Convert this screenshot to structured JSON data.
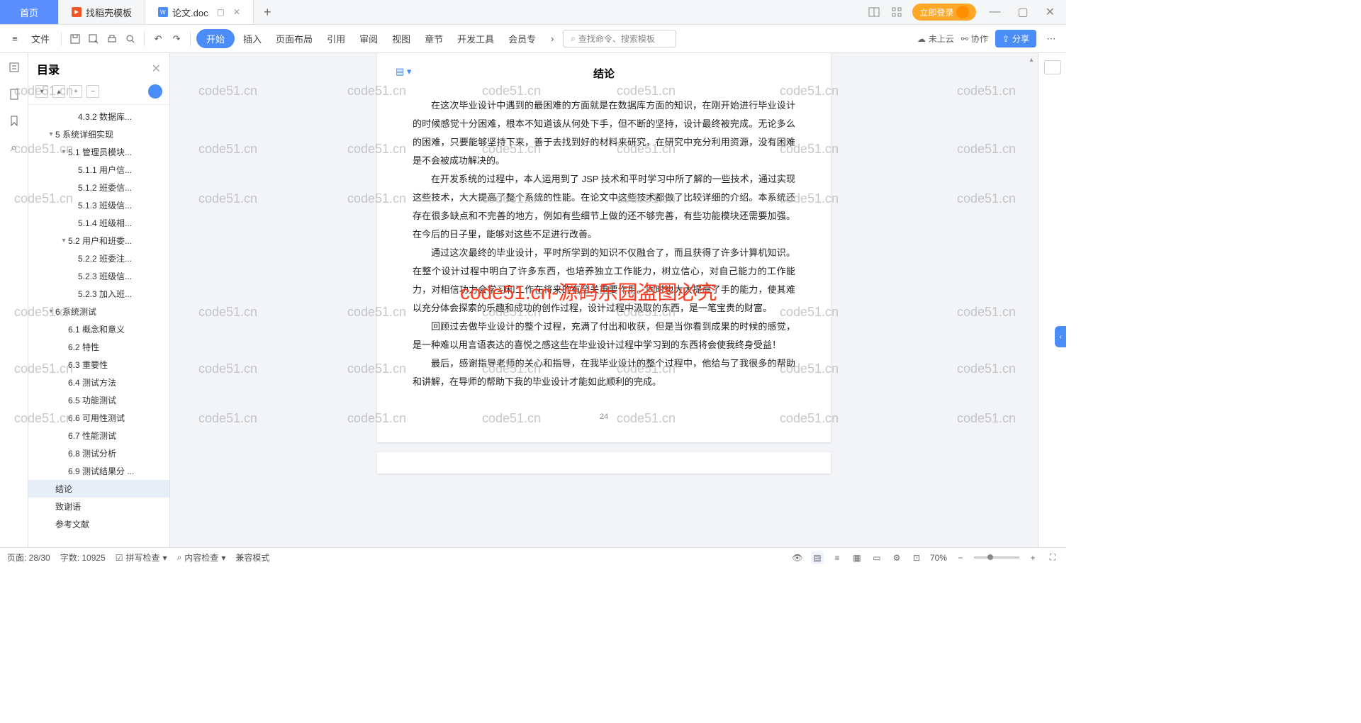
{
  "tabs": {
    "home": "首页",
    "template": "找稻壳模板",
    "doc": "论文.doc",
    "add": "+"
  },
  "topRight": {
    "login": "立即登录"
  },
  "toolbar": {
    "file": "文件",
    "menus": [
      "开始",
      "插入",
      "页面布局",
      "引用",
      "审阅",
      "视图",
      "章节",
      "开发工具",
      "会员专"
    ],
    "search_ph": "查找命令、搜索模板",
    "cloud": "未上云",
    "coop": "协作",
    "share": "分享"
  },
  "outline": {
    "title": "目录",
    "items": [
      {
        "l": 3,
        "t": "4.3.2 数据库...",
        "caret": ""
      },
      {
        "l": 1,
        "t": "5 系统详细实现",
        "caret": "▾"
      },
      {
        "l": 2,
        "t": "5.1 管理员模块...",
        "caret": "▾"
      },
      {
        "l": 3,
        "t": "5.1.1 用户信...",
        "caret": ""
      },
      {
        "l": 3,
        "t": "5.1.2 班委信...",
        "caret": ""
      },
      {
        "l": 3,
        "t": "5.1.3 班级信...",
        "caret": ""
      },
      {
        "l": 3,
        "t": "5.1.4 班级相...",
        "caret": ""
      },
      {
        "l": 2,
        "t": "5.2 用户和班委...",
        "caret": "▾"
      },
      {
        "l": 3,
        "t": "5.2.2 班委注...",
        "caret": ""
      },
      {
        "l": 3,
        "t": "5.2.3 班级信...",
        "caret": ""
      },
      {
        "l": 3,
        "t": "5.2.3 加入班...",
        "caret": ""
      },
      {
        "l": 1,
        "t": "6 系统测试",
        "caret": "▾"
      },
      {
        "l": 2,
        "t": "6.1 概念和意义",
        "caret": ""
      },
      {
        "l": 2,
        "t": "6.2 特性",
        "caret": ""
      },
      {
        "l": 2,
        "t": "6.3 重要性",
        "caret": ""
      },
      {
        "l": 2,
        "t": "6.4 测试方法",
        "caret": ""
      },
      {
        "l": 2,
        "t": "6.5 功能测试",
        "caret": ""
      },
      {
        "l": 2,
        "t": "6.6 可用性测试",
        "caret": ""
      },
      {
        "l": 2,
        "t": "6.7 性能测试",
        "caret": ""
      },
      {
        "l": 2,
        "t": "6.8 测试分析",
        "caret": ""
      },
      {
        "l": 2,
        "t": "6.9 测试结果分 ...",
        "caret": ""
      },
      {
        "l": 1,
        "t": "结论",
        "caret": "",
        "sel": true
      },
      {
        "l": 1,
        "t": "致谢语",
        "caret": ""
      },
      {
        "l": 1,
        "t": "参考文献",
        "caret": ""
      }
    ]
  },
  "doc": {
    "title": "结论",
    "paras": [
      "在这次毕业设计中遇到的最困难的方面就是在数据库方面的知识，在刚开始进行毕业设计的时候感觉十分困难，根本不知道该从何处下手，但不断的坚持，设计最终被完成。无论多么的困难，只要能够坚持下来，善于去找到好的材料来研究，在研究中充分利用资源，没有困难是不会被成功解决的。",
      "在开发系统的过程中，本人运用到了 JSP 技术和平时学习中所了解的一些技术，通过实现这些技术，大大提高了整个系统的性能。在论文中这些技术都做了比较详细的介绍。本系统还存在很多缺点和不完善的地方，例如有些细节上做的还不够完善，有些功能模块还需要加强。在今后的日子里，能够对这些不足进行改善。",
      "通过这次最终的毕业设计，平时所学到的知识不仅融合了，而且获得了许多计算机知识。在整个设计过程中明白了许多东西，也培养独立工作能力，树立信心，对自己能力的工作能力，对相信功力会学习和工作在将来的有至关重要作用。同时也大大提高了手的能力，使其难以充分体会探索的乐趣和成功的创作过程，设计过程中汲取的东西，是一笔宝贵的财富。",
      "回顾过去做毕业设计的整个过程，充满了付出和收获，但是当你看到成果的时候的感觉，是一种难以用言语表达的喜悦之感这些在毕业设计过程中学习到的东西将会使我终身受益！",
      "最后，感谢指导老师的关心和指导，在我毕业设计的整个过程中，他给与了我很多的帮助和讲解，在导师的帮助下我的毕业设计才能如此顺利的完成。"
    ],
    "pageNum": "24"
  },
  "watermarks": {
    "grey": "code51.cn",
    "red": "code51.cn-源码乐园盗图必究"
  },
  "status": {
    "page": "页面: 28/30",
    "words": "字数: 10925",
    "spell": "拼写检查",
    "content": "内容检查",
    "compat": "兼容模式",
    "zoom": "70%"
  }
}
